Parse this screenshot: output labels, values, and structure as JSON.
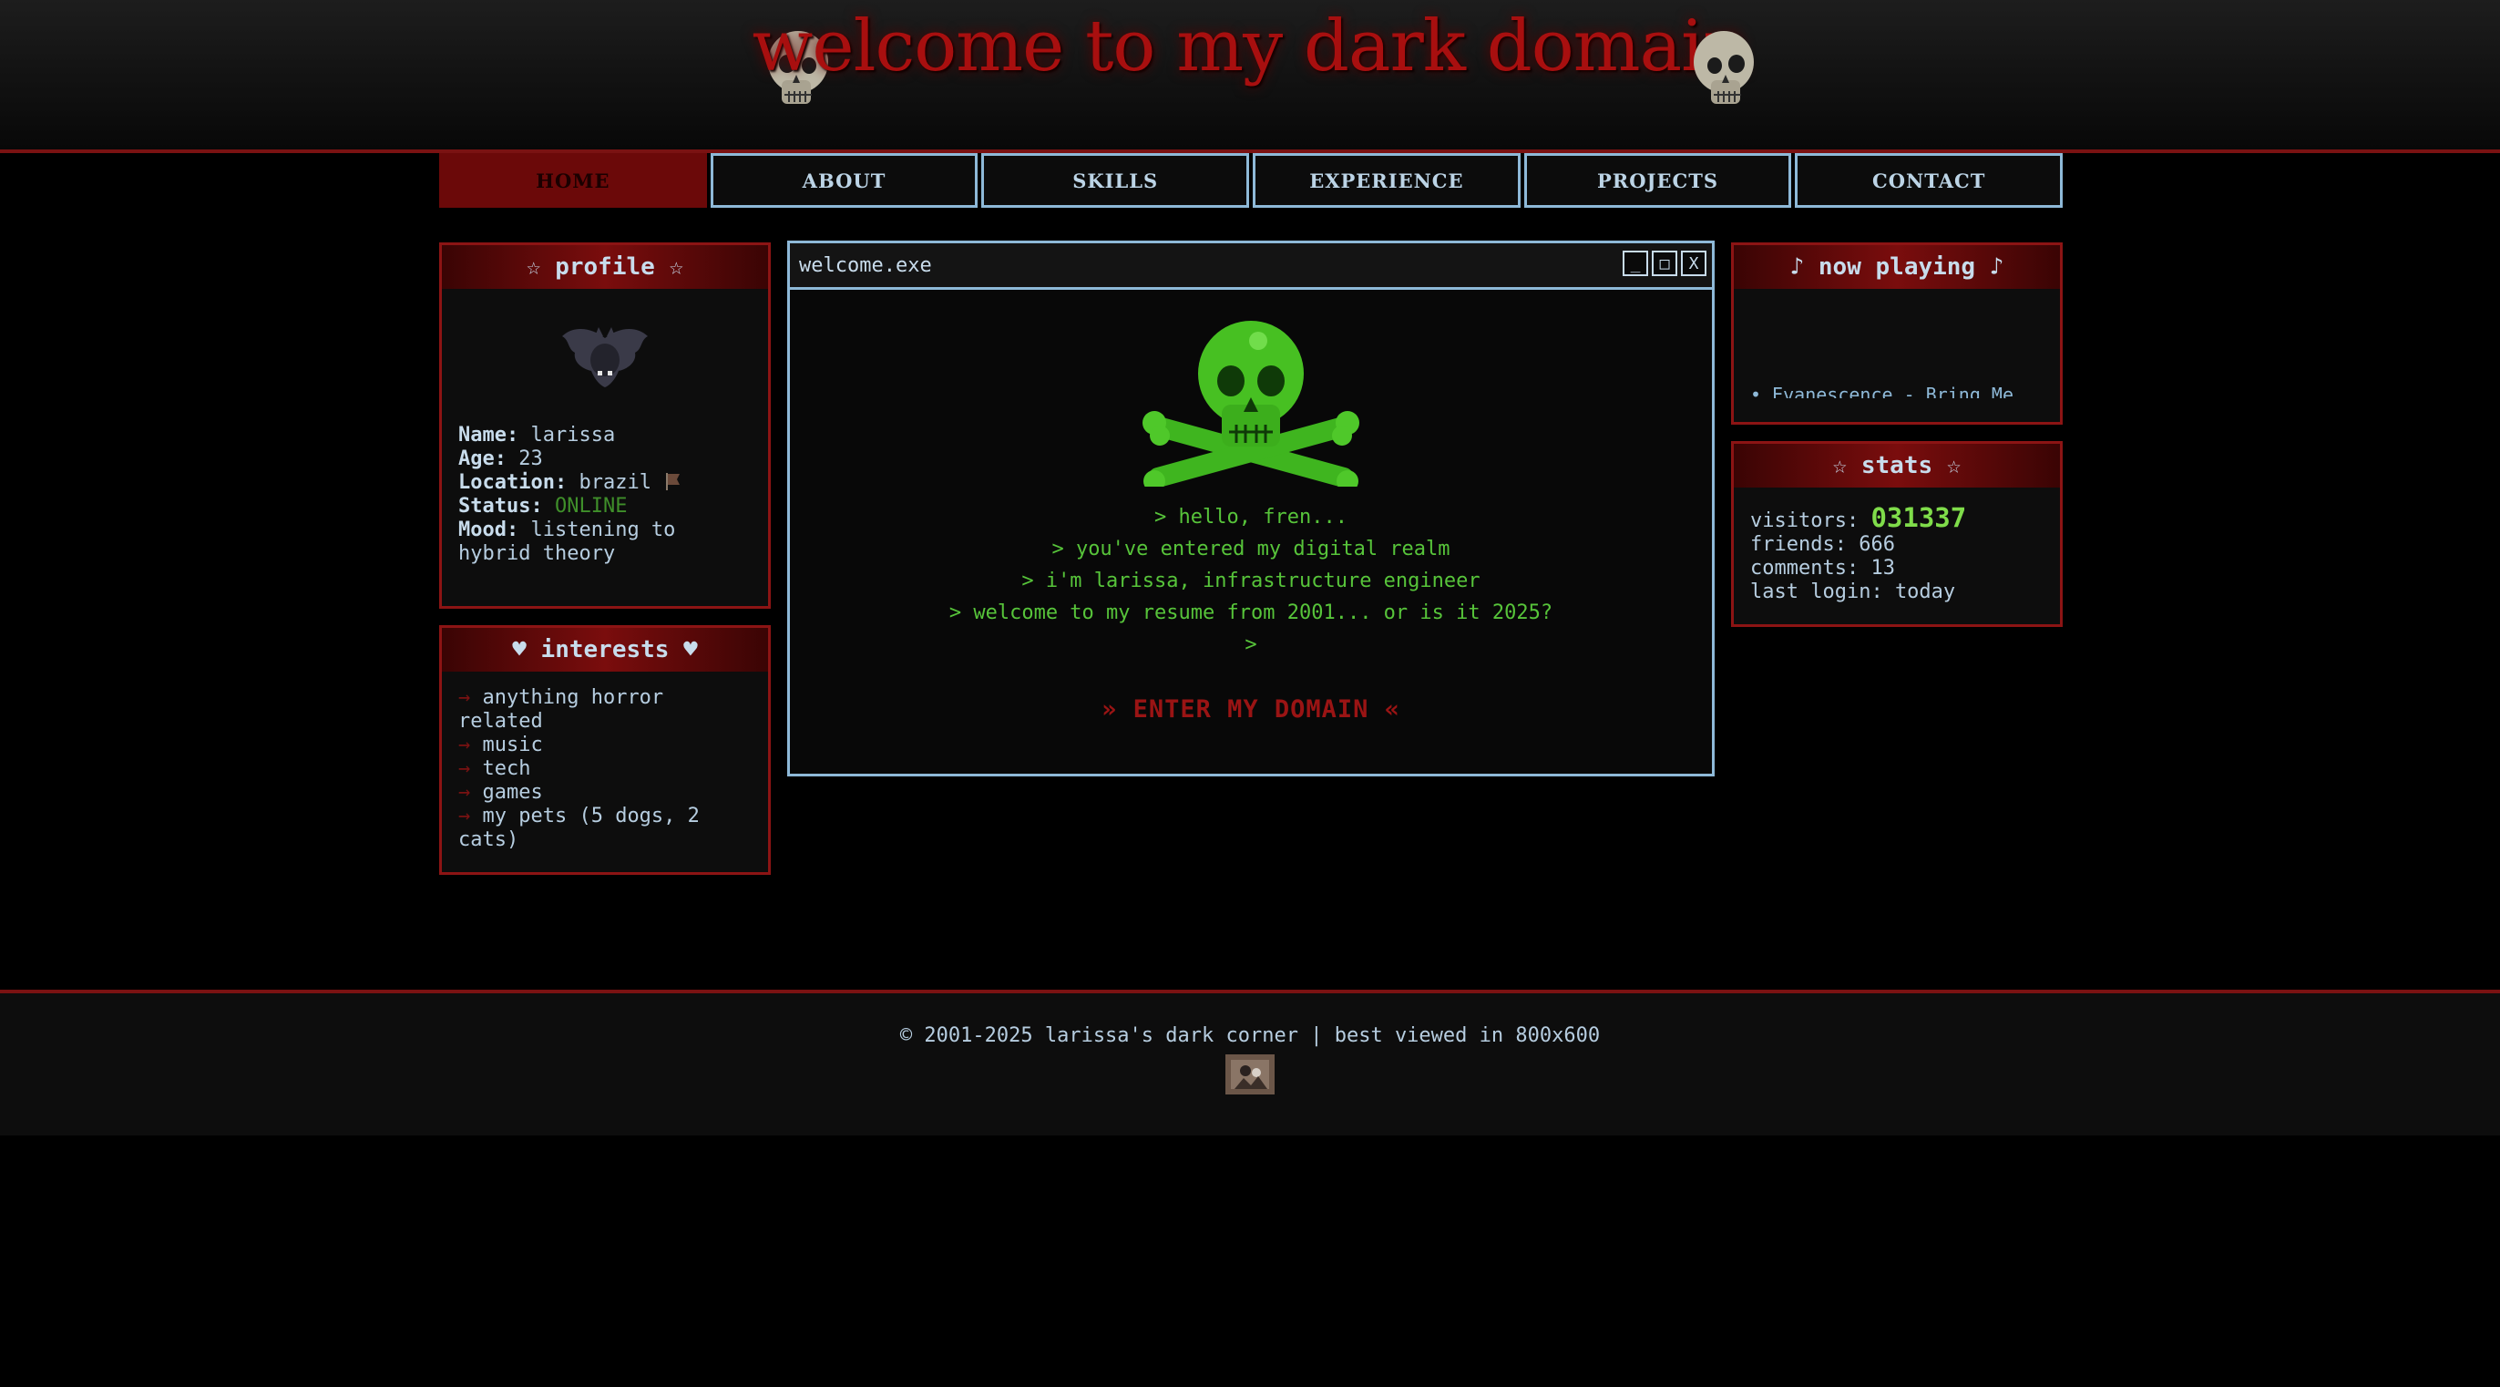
{
  "header": {
    "title": "welcome to my dark domain",
    "skull_icon": "skull-icon"
  },
  "nav": {
    "items": [
      {
        "label": "HOME",
        "active": true
      },
      {
        "label": "ABOUT"
      },
      {
        "label": "SKILLS"
      },
      {
        "label": "EXPERIENCE"
      },
      {
        "label": "PROJECTS"
      },
      {
        "label": "CONTACT"
      }
    ]
  },
  "profile": {
    "heading": "☆ profile ☆",
    "avatar_icon": "bat-icon",
    "fields": [
      {
        "label": "Name:",
        "value": "larissa"
      },
      {
        "label": "Age:",
        "value": "23"
      },
      {
        "label": "Location:",
        "value": "brazil"
      },
      {
        "label": "Status:",
        "value": "ONLINE"
      },
      {
        "label": "Mood:",
        "value": "listening to hybrid theory"
      }
    ]
  },
  "interests": {
    "heading": "♥ interests ♥",
    "bullet": "→",
    "items": [
      "anything horror related",
      "music",
      "tech",
      "games",
      "my pets (5 dogs, 2 cats)"
    ]
  },
  "window": {
    "title": "welcome.exe",
    "buttons": [
      "_",
      "□",
      "X"
    ],
    "lines": [
      "> hello, fren...",
      "> you've entered my digital realm",
      "> i'm larissa, infrastructure engineer",
      "> welcome to my resume from 2001... or is it 2025?",
      ">"
    ],
    "enter_label": "» ENTER MY DOMAIN «"
  },
  "now_playing": {
    "heading": "♪ now playing ♪",
    "track": "• Evanescence - Bring Me"
  },
  "stats": {
    "heading": "☆ stats ☆",
    "visitors_label": "visitors:",
    "visitors_value": "031337",
    "friends": "friends: 666",
    "comments": "comments: 13",
    "last_login": "last login: today"
  },
  "footer": {
    "text": "© 2001-2025 larissa's dark corner | best viewed in 800x600"
  },
  "colors": {
    "accent_red": "#8c1414",
    "title_red": "#a80f0f",
    "border_blue": "#8eb9d8",
    "terminal_green": "#57c43a",
    "online_green": "#3f8f2a"
  }
}
